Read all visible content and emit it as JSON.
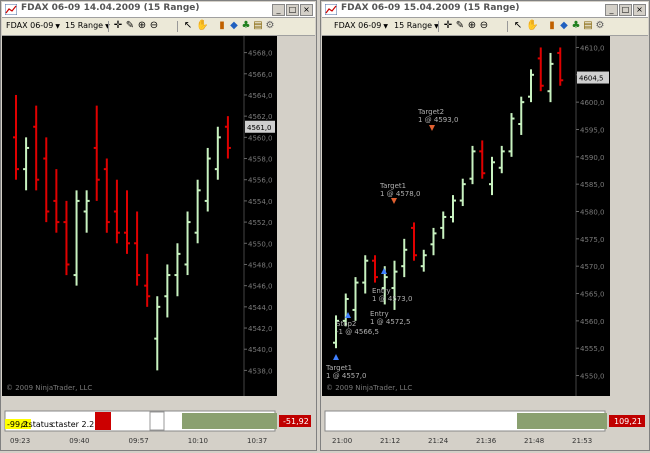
{
  "colors": {
    "up": "#c8f2c0",
    "down": "#e00000",
    "axis_text": "#7a7a7a",
    "bg": "#000000",
    "grid_line": "#2a2a2a"
  },
  "left": {
    "title": "FDAX 06-09  14.04.2009 (15 Range)",
    "instrument": "FDAX 06-09",
    "period": "15 Range",
    "copyright": "© 2009 NinjaTrader, LLC",
    "price_label": "4561,0",
    "y_ticks": [
      "4568,0",
      "4566,0",
      "4564,0",
      "4562,0",
      "4560,0",
      "4558,0",
      "4556,0",
      "4554,0",
      "4552,0",
      "4550,0",
      "4548,0",
      "4546,0",
      "4544,0",
      "4542,0",
      "4540,0",
      "4538,0"
    ],
    "x_ticks": [
      "09:23",
      "09:40",
      "09:57",
      "10:10",
      "10:37"
    ],
    "strategy_text_1": "-99,2",
    "strategy_text_2": "ctstatus",
    "strategy_text_3": "ctaster 2.2",
    "pnl": "-51,92",
    "icons": [
      "chart-icon",
      "crosshair-icon",
      "pencil-icon",
      "zoom-in-icon",
      "zoom-out-icon",
      "cursor-icon",
      "hand-icon",
      "bar-type-icon",
      "indicator-icon",
      "strategy-icon",
      "save-icon",
      "properties-icon"
    ]
  },
  "right": {
    "title": "FDAX 06-09  15.04.2009 (15 Range)",
    "instrument": "FDAX 06-09",
    "period": "15 Range",
    "copyright": "© 2009 NinjaTrader, LLC",
    "price_label": "4604,5",
    "y_ticks": [
      "4610,0",
      "4605,0",
      "4600,0",
      "4595,0",
      "4590,0",
      "4585,0",
      "4580,0",
      "4575,0",
      "4570,0",
      "4565,0",
      "4560,0",
      "4555,0",
      "4550,0"
    ],
    "x_ticks": [
      "21:00",
      "21:12",
      "21:24",
      "21:36",
      "21:48",
      "21:53"
    ],
    "annotations": [
      {
        "label": "Target2",
        "text": "1 @ 4593,0"
      },
      {
        "label": "Target1",
        "text": "1 @ 4578,0"
      },
      {
        "label": "Entry",
        "text": "1 @ 4573,0"
      },
      {
        "label": "Entry",
        "text": "1 @ 4572,5"
      },
      {
        "label": "Stop2",
        "text": "-1 @ 4566,5"
      },
      {
        "label": "Target1",
        "text": "1 @ 4557,0"
      }
    ],
    "pnl": "109,21"
  },
  "chart_data": [
    {
      "type": "bar",
      "subtype": "range-bars-ohlc",
      "title": "FDAX 06-09 14.04.2009 (15 Range)",
      "ylim": [
        4537,
        4569
      ],
      "bars": [
        {
          "o": 4560,
          "h": 4564,
          "l": 4556,
          "c": 4557,
          "dir": "down"
        },
        {
          "o": 4557,
          "h": 4560,
          "l": 4555,
          "c": 4559,
          "dir": "up"
        },
        {
          "o": 4561,
          "h": 4563,
          "l": 4555,
          "c": 4556,
          "dir": "down"
        },
        {
          "o": 4558,
          "h": 4560,
          "l": 4552,
          "c": 4553,
          "dir": "down"
        },
        {
          "o": 4554,
          "h": 4557,
          "l": 4551,
          "c": 4552,
          "dir": "down"
        },
        {
          "o": 4552,
          "h": 4554,
          "l": 4547,
          "c": 4548,
          "dir": "down"
        },
        {
          "o": 4547,
          "h": 4555,
          "l": 4546,
          "c": 4554,
          "dir": "up"
        },
        {
          "o": 4553,
          "h": 4555,
          "l": 4551,
          "c": 4554,
          "dir": "up"
        },
        {
          "o": 4559,
          "h": 4563,
          "l": 4554,
          "c": 4556,
          "dir": "down"
        },
        {
          "o": 4557,
          "h": 4558,
          "l": 4551,
          "c": 4552,
          "dir": "down"
        },
        {
          "o": 4553,
          "h": 4556,
          "l": 4550,
          "c": 4551,
          "dir": "down"
        },
        {
          "o": 4551,
          "h": 4555,
          "l": 4549,
          "c": 4550,
          "dir": "down"
        },
        {
          "o": 4550,
          "h": 4553,
          "l": 4546,
          "c": 4547,
          "dir": "down"
        },
        {
          "o": 4546,
          "h": 4549,
          "l": 4544,
          "c": 4545,
          "dir": "down"
        },
        {
          "o": 4541,
          "h": 4545,
          "l": 4538,
          "c": 4544,
          "dir": "up"
        },
        {
          "o": 4545,
          "h": 4548,
          "l": 4543,
          "c": 4547,
          "dir": "up"
        },
        {
          "o": 4547,
          "h": 4550,
          "l": 4545,
          "c": 4549,
          "dir": "up"
        },
        {
          "o": 4548,
          "h": 4553,
          "l": 4547,
          "c": 4552,
          "dir": "up"
        },
        {
          "o": 4551,
          "h": 4556,
          "l": 4550,
          "c": 4555,
          "dir": "up"
        },
        {
          "o": 4554,
          "h": 4559,
          "l": 4553,
          "c": 4558,
          "dir": "up"
        },
        {
          "o": 4557,
          "h": 4561,
          "l": 4556,
          "c": 4560,
          "dir": "up"
        },
        {
          "o": 4561,
          "h": 4562,
          "l": 4558,
          "c": 4559,
          "dir": "down"
        }
      ]
    },
    {
      "type": "bar",
      "subtype": "range-bars-ohlc",
      "title": "FDAX 06-09 15.04.2009 (15 Range)",
      "ylim": [
        4549,
        4611
      ],
      "bars": [
        {
          "o": 4556,
          "h": 4561,
          "l": 4555,
          "c": 4560,
          "dir": "up"
        },
        {
          "o": 4560,
          "h": 4565,
          "l": 4559,
          "c": 4564,
          "dir": "up"
        },
        {
          "o": 4562,
          "h": 4568,
          "l": 4560,
          "c": 4567,
          "dir": "up"
        },
        {
          "o": 4567,
          "h": 4572,
          "l": 4565,
          "c": 4571,
          "dir": "up"
        },
        {
          "o": 4571,
          "h": 4572,
          "l": 4567,
          "c": 4568,
          "dir": "down"
        },
        {
          "o": 4566,
          "h": 4570,
          "l": 4563,
          "c": 4568,
          "dir": "up"
        },
        {
          "o": 4566,
          "h": 4571,
          "l": 4562,
          "c": 4569,
          "dir": "up"
        },
        {
          "o": 4570,
          "h": 4575,
          "l": 4568,
          "c": 4573,
          "dir": "up"
        },
        {
          "o": 4577,
          "h": 4578,
          "l": 4571,
          "c": 4572,
          "dir": "down"
        },
        {
          "o": 4570,
          "h": 4573,
          "l": 4569,
          "c": 4572,
          "dir": "up"
        },
        {
          "o": 4574,
          "h": 4577,
          "l": 4572,
          "c": 4576,
          "dir": "up"
        },
        {
          "o": 4577,
          "h": 4580,
          "l": 4575,
          "c": 4579,
          "dir": "up"
        },
        {
          "o": 4579,
          "h": 4583,
          "l": 4578,
          "c": 4582,
          "dir": "up"
        },
        {
          "o": 4582,
          "h": 4586,
          "l": 4581,
          "c": 4585,
          "dir": "up"
        },
        {
          "o": 4586,
          "h": 4592,
          "l": 4585,
          "c": 4591,
          "dir": "up"
        },
        {
          "o": 4591,
          "h": 4593,
          "l": 4586,
          "c": 4587,
          "dir": "down"
        },
        {
          "o": 4585,
          "h": 4590,
          "l": 4583,
          "c": 4589,
          "dir": "up"
        },
        {
          "o": 4588,
          "h": 4592,
          "l": 4587,
          "c": 4591,
          "dir": "up"
        },
        {
          "o": 4591,
          "h": 4598,
          "l": 4590,
          "c": 4597,
          "dir": "up"
        },
        {
          "o": 4596,
          "h": 4601,
          "l": 4594,
          "c": 4600,
          "dir": "up"
        },
        {
          "o": 4601,
          "h": 4606,
          "l": 4600,
          "c": 4605,
          "dir": "up"
        },
        {
          "o": 4608,
          "h": 4610,
          "l": 4602,
          "c": 4603,
          "dir": "down"
        },
        {
          "o": 4602,
          "h": 4609,
          "l": 4600,
          "c": 4607,
          "dir": "up"
        },
        {
          "o": 4609,
          "h": 4610,
          "l": 4603,
          "c": 4604,
          "dir": "down"
        }
      ]
    }
  ]
}
